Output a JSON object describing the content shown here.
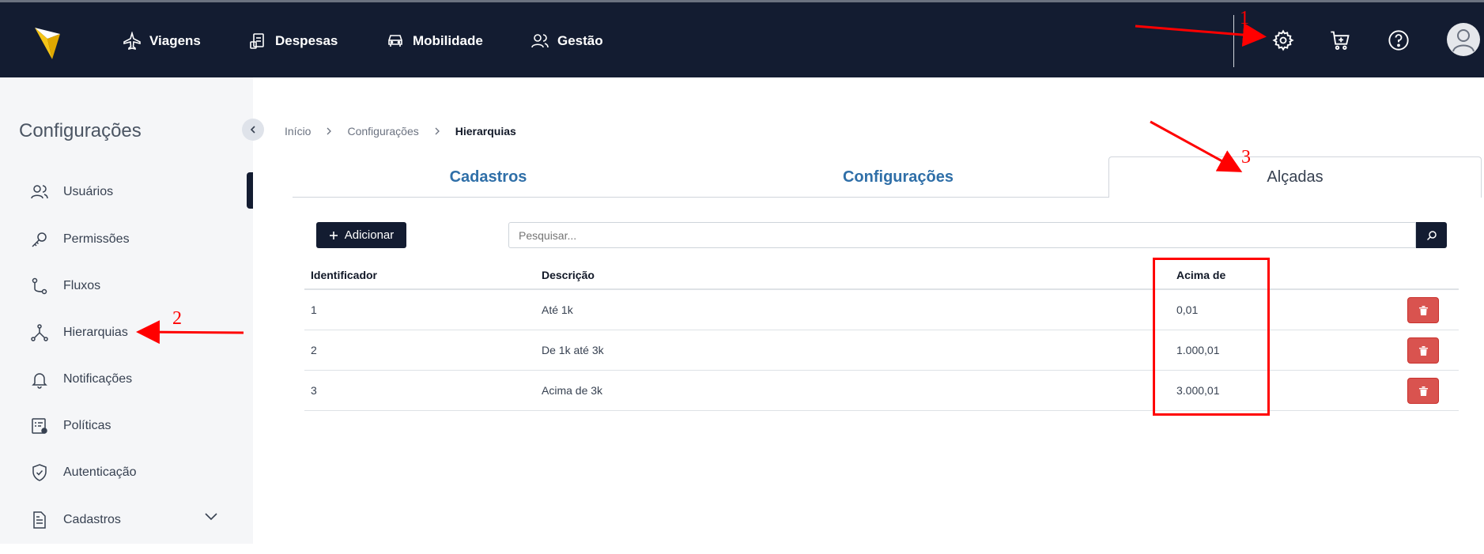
{
  "nav": {
    "items": [
      {
        "label": "Viagens",
        "icon": "airplane-icon"
      },
      {
        "label": "Despesas",
        "icon": "receipt-icon"
      },
      {
        "label": "Mobilidade",
        "icon": "car-icon"
      },
      {
        "label": "Gestão",
        "icon": "users-icon"
      }
    ]
  },
  "sidebar": {
    "title": "Configurações",
    "items": [
      {
        "label": "Usuários",
        "icon": "users-icon"
      },
      {
        "label": "Permissões",
        "icon": "key-icon"
      },
      {
        "label": "Fluxos",
        "icon": "flow-icon"
      },
      {
        "label": "Hierarquias",
        "icon": "hierarchy-icon"
      },
      {
        "label": "Notificações",
        "icon": "bell-icon"
      },
      {
        "label": "Políticas",
        "icon": "policy-icon"
      },
      {
        "label": "Autenticação",
        "icon": "shield-icon"
      },
      {
        "label": "Cadastros",
        "icon": "document-icon"
      }
    ]
  },
  "breadcrumb": [
    "Início",
    "Configurações",
    "Hierarquias"
  ],
  "tabs": [
    "Cadastros",
    "Configurações",
    "Alçadas"
  ],
  "toolbar": {
    "add_label": "Adicionar",
    "search_placeholder": "Pesquisar..."
  },
  "table": {
    "headers": [
      "Identificador",
      "Descrição",
      "Acima de"
    ],
    "rows": [
      {
        "id": "1",
        "description": "Até 1k",
        "above": "0,01"
      },
      {
        "id": "2",
        "description": "De 1k até 3k",
        "above": "1.000,01"
      },
      {
        "id": "3",
        "description": "Acima de 3k",
        "above": "3.000,01"
      }
    ]
  },
  "annotations": [
    "1",
    "2",
    "3"
  ],
  "colors": {
    "navbar": "#131c31",
    "tab_link": "#2f6fa8",
    "delete": "#d9534f",
    "annotation": "#ff0000"
  }
}
